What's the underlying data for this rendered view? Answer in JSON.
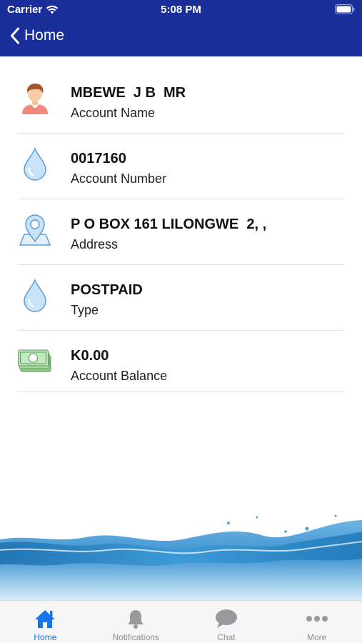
{
  "status_bar": {
    "carrier": "Carrier",
    "time": "5:08 PM"
  },
  "nav": {
    "back_label": "Home"
  },
  "account_items": [
    {
      "value": "MBEWE  J B  MR",
      "label": "Account Name",
      "icon": "person-icon"
    },
    {
      "value": "0017160",
      "label": "Account Number",
      "icon": "water-drop-icon"
    },
    {
      "value": "P O BOX 161 LILONGWE  2, ,",
      "label": "Address",
      "icon": "location-pin-icon"
    },
    {
      "value": "POSTPAID",
      "label": "Type",
      "icon": "water-drop-icon"
    },
    {
      "value": "K0.00",
      "label": "Account Balance",
      "icon": "cash-icon"
    }
  ],
  "tabs": [
    {
      "label": "Home",
      "icon": "home-icon",
      "active": true
    },
    {
      "label": "Notifications",
      "icon": "bell-icon",
      "active": false
    },
    {
      "label": "Chat",
      "icon": "chat-bubble-icon",
      "active": false
    },
    {
      "label": "More",
      "icon": "more-dots-icon",
      "active": false
    }
  ],
  "colors": {
    "header": "#1a2f9a",
    "active_tab": "#1a73e8",
    "inactive_tab": "#8e8e93"
  }
}
